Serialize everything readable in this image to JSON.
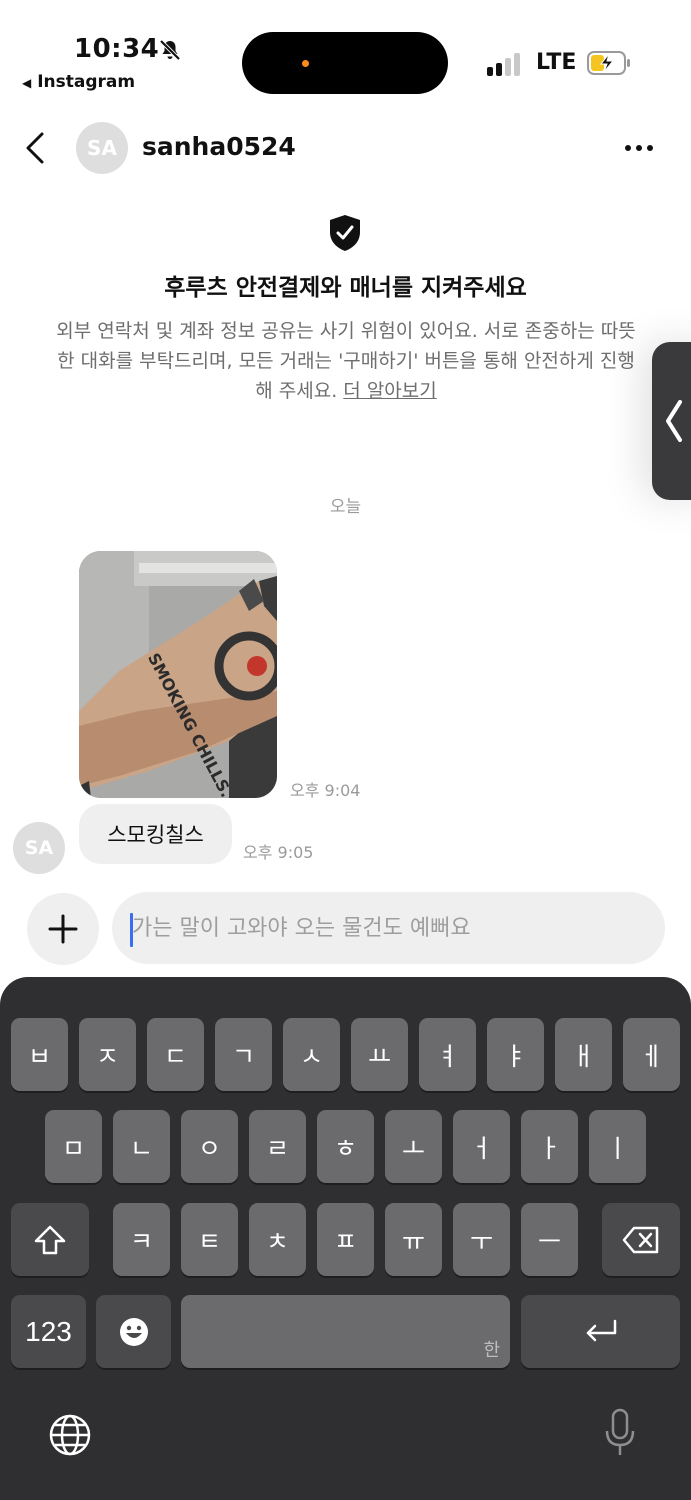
{
  "status_bar": {
    "time": "10:34",
    "back_app": "Instagram",
    "carrier": "LTE"
  },
  "header": {
    "avatar_initials": "SA",
    "username": "sanha0524"
  },
  "notice": {
    "title": "후루츠 안전결제와 매너를 지켜주세요",
    "body": "외부 연락처 및 계좌 정보 공유는 사기 위험이 있어요. 서로 존중하는 따뜻한 대화를 부탁드리며, 모든 거래는 '구매하기' 버튼을 통해 안전하게 진행해 주세요.",
    "link": "더 알아보기"
  },
  "chat": {
    "date_divider": "오늘",
    "messages": [
      {
        "type": "image",
        "image_text": "SMOKING CHILLS.",
        "time": "오후 9:04"
      },
      {
        "type": "text",
        "text": "스모킹칠스",
        "time": "오후 9:05",
        "avatar": "SA"
      }
    ]
  },
  "composer": {
    "placeholder": "가는 말이 고와야 오는 물건도 예뻐요"
  },
  "keyboard": {
    "row1": [
      "ㅂ",
      "ㅈ",
      "ㄷ",
      "ㄱ",
      "ㅅ",
      "ㅛ",
      "ㅕ",
      "ㅑ",
      "ㅐ",
      "ㅔ"
    ],
    "row2": [
      "ㅁ",
      "ㄴ",
      "ㅇ",
      "ㄹ",
      "ㅎ",
      "ㅗ",
      "ㅓ",
      "ㅏ",
      "ㅣ"
    ],
    "row3": [
      "ㅋ",
      "ㅌ",
      "ㅊ",
      "ㅍ",
      "ㅠ",
      "ㅜ",
      "ㅡ"
    ],
    "numbers_label": "123",
    "space_sub_label": "한"
  },
  "colors": {
    "accent_caret": "#3a6cf6",
    "keyboard_bg": "#2f2f31",
    "key_bg": "#6b6b6d",
    "bubble_bg": "#efefef",
    "notification_dot": "#ff8a1c"
  }
}
